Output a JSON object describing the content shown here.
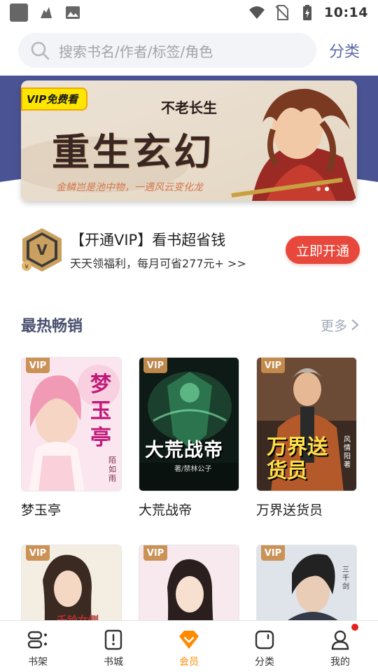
{
  "status_bar": {
    "time": "10:14",
    "icons": [
      "app-square-icon",
      "notification-icon",
      "image-icon",
      "wifi-icon",
      "no-sim-icon",
      "battery-charging-icon"
    ]
  },
  "search": {
    "placeholder": "搜索书名/作者/标签/角色",
    "category_label": "分类"
  },
  "banner": {
    "vip_badge": "VIP免费看",
    "subtitle": "不老长生",
    "title": "重生玄幻",
    "tagline": "金鳞岂是池中物，一遇风云变化龙",
    "page_count": 2,
    "active_page": 1
  },
  "vip_promo": {
    "title": "【开通VIP】看书超省钱",
    "description": "天天领福利，每月可省277元+ >>",
    "button_label": "立即开通",
    "medal_letter": "V",
    "colors": {
      "button": "#e8483c",
      "medal": "#c9a060"
    }
  },
  "hot_section": {
    "title": "最热畅销",
    "more_label": "更多",
    "books": [
      {
        "name": "梦玉亭",
        "vip": "VIP",
        "cover_text": "梦玉亭",
        "cover_author": "陌如雨"
      },
      {
        "name": "大荒战帝",
        "vip": "VIP",
        "cover_text": "大荒战帝",
        "cover_author": "著/禁林公子"
      },
      {
        "name": "万界送货员",
        "vip": "VIP",
        "cover_text": "万界送货员",
        "cover_author": "风情阳著"
      },
      {
        "name": "",
        "vip": "VIP",
        "cover_text": "千铃女侧",
        "cover_author": ""
      },
      {
        "name": "",
        "vip": "VIP",
        "cover_text": "",
        "cover_author": ""
      },
      {
        "name": "",
        "vip": "VIP",
        "cover_text": "",
        "cover_author": "三千剑"
      }
    ]
  },
  "bottom_nav": {
    "items": [
      {
        "label": "书架",
        "icon": "bookshelf-icon"
      },
      {
        "label": "书城",
        "icon": "bookstore-icon"
      },
      {
        "label": "会员",
        "icon": "vip-tag-icon",
        "active": true
      },
      {
        "label": "分类",
        "icon": "category-icon"
      },
      {
        "label": "我的",
        "icon": "profile-icon",
        "badge": true
      }
    ],
    "active_color": "#ff8a00"
  }
}
